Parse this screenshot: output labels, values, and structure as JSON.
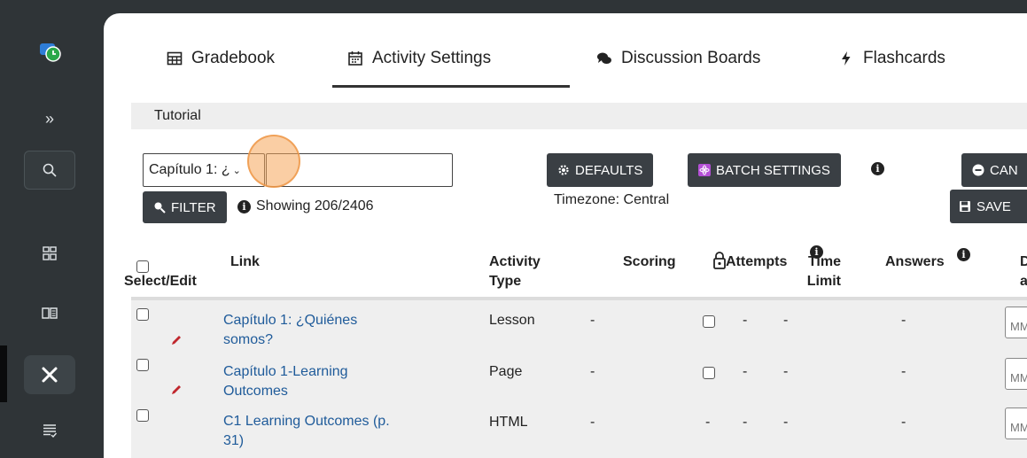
{
  "nav": {
    "items": [
      {
        "name": "expand",
        "icon": "double-chevron-right-icon",
        "glyph": "»"
      },
      {
        "name": "search",
        "icon": "search-icon"
      },
      {
        "name": "dashboard",
        "icon": "dashboard-icon"
      },
      {
        "name": "book",
        "icon": "book-icon"
      },
      {
        "name": "tools",
        "icon": "tools-icon",
        "active": true
      },
      {
        "name": "list",
        "icon": "list-icon"
      }
    ]
  },
  "tabs": [
    {
      "label": "Gradebook",
      "icon": "table-icon"
    },
    {
      "label": "Activity Settings",
      "icon": "calendar-icon",
      "active": true
    },
    {
      "label": "Discussion Boards",
      "icon": "comments-icon"
    },
    {
      "label": "Flashcards",
      "icon": "bolt-icon"
    }
  ],
  "breadcrumb": "Tutorial",
  "filter": {
    "selected": "Capítulo 1: ¿",
    "search_value": "",
    "button": "FILTER",
    "showing": "Showing 206/2406"
  },
  "toolbar": {
    "defaults": "DEFAULTS",
    "batch": "BATCH SETTINGS",
    "cancel": "CAN",
    "save": "SAVE",
    "timezone": "Timezone: Central"
  },
  "columns": {
    "select_edit": "Select/Edit",
    "link": "Link",
    "activity_type_1": "Activity",
    "activity_type_2": "Type",
    "scoring": "Scoring",
    "attempts": "Attempts",
    "time_1": "Time",
    "time_2": "Limit",
    "answers": "Answers",
    "due_1": "D",
    "due_2": "a"
  },
  "rows": [
    {
      "link_1": "Capítulo 1: ¿Quiénes",
      "link_2": "somos?",
      "type": "Lesson",
      "scoring": "-",
      "attempts": "-",
      "time": "-",
      "answers": "-",
      "date_placeholder": "MM",
      "has_check": true,
      "has_edit": true
    },
    {
      "link_1": "Capítulo 1-Learning",
      "link_2": "Outcomes",
      "type": "Page",
      "scoring": "-",
      "attempts": "-",
      "time": "-",
      "answers": "-",
      "date_placeholder": "MM",
      "has_check": true,
      "has_edit": true
    },
    {
      "link_1": "C1 Learning Outcomes (p.",
      "link_2": "31)",
      "type": "HTML",
      "scoring": "-",
      "lock": "-",
      "attempts": "-",
      "time": "-",
      "answers": "-",
      "date_placeholder": "MM",
      "has_check": false,
      "has_edit": false
    }
  ],
  "colors": {
    "accent": "#1f5b9a",
    "rail": "#2f3437",
    "button": "#3a3f44",
    "edit": "#c0272d"
  }
}
